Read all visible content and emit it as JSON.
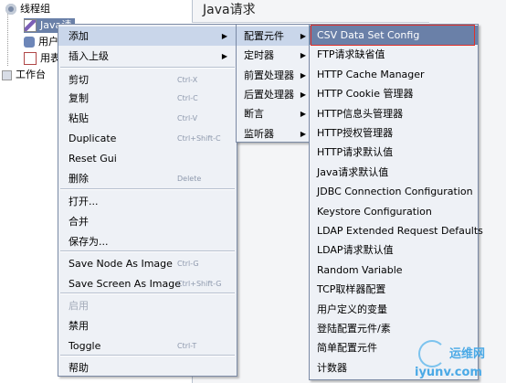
{
  "tree": {
    "items": [
      {
        "label": "线程组",
        "icon": "gear-icon"
      },
      {
        "label": "Java请",
        "icon": "pen-icon"
      },
      {
        "label": "用户",
        "icon": "user-icon"
      },
      {
        "label": "用表",
        "icon": "graph-icon"
      },
      {
        "label": "工作台",
        "icon": "workbench-icon"
      }
    ]
  },
  "panel": {
    "title": "Java请求"
  },
  "context_menu": {
    "items": [
      {
        "label": "添加",
        "accel": "",
        "submenu": true,
        "state": "highlighted"
      },
      {
        "label": "插入上级",
        "accel": "",
        "submenu": true
      },
      {
        "label": "剪切",
        "accel": "Ctrl-X"
      },
      {
        "label": "复制",
        "accel": "Ctrl-C"
      },
      {
        "label": "粘贴",
        "accel": "Ctrl-V"
      },
      {
        "label": "Duplicate",
        "accel": "Ctrl+Shift-C"
      },
      {
        "label": "Reset Gui",
        "accel": ""
      },
      {
        "label": "删除",
        "accel": "Delete"
      },
      {
        "label": "打开...",
        "accel": ""
      },
      {
        "label": "合并",
        "accel": ""
      },
      {
        "label": "保存为...",
        "accel": ""
      },
      {
        "label": "Save Node As Image",
        "accel": "Ctrl-G"
      },
      {
        "label": "Save Screen As Image",
        "accel": "Ctrl+Shift-G"
      },
      {
        "label": "启用",
        "accel": "",
        "state": "disabled"
      },
      {
        "label": "禁用",
        "accel": ""
      },
      {
        "label": "Toggle",
        "accel": "Ctrl-T"
      },
      {
        "label": "帮助",
        "accel": ""
      }
    ]
  },
  "add_submenu": {
    "items": [
      {
        "label": "配置元件",
        "state": "highlighted"
      },
      {
        "label": "定时器"
      },
      {
        "label": "前置处理器"
      },
      {
        "label": "后置处理器"
      },
      {
        "label": "断言"
      },
      {
        "label": "监听器"
      }
    ]
  },
  "config_submenu": {
    "items": [
      {
        "label": "CSV Data Set Config",
        "state": "selected"
      },
      {
        "label": "FTP请求缺省值"
      },
      {
        "label": "HTTP Cache Manager"
      },
      {
        "label": "HTTP Cookie 管理器"
      },
      {
        "label": "HTTP信息头管理器"
      },
      {
        "label": "HTTP授权管理器"
      },
      {
        "label": "HTTP请求默认值"
      },
      {
        "label": "Java请求默认值"
      },
      {
        "label": "JDBC Connection Configuration"
      },
      {
        "label": "Keystore Configuration"
      },
      {
        "label": "LDAP Extended Request Defaults"
      },
      {
        "label": "LDAP请求默认值"
      },
      {
        "label": "Random Variable"
      },
      {
        "label": "TCP取样器配置"
      },
      {
        "label": "用户定义的变量"
      },
      {
        "label": "登陆配置元件/素"
      },
      {
        "label": "简单配置元件"
      },
      {
        "label": "计数器"
      }
    ]
  },
  "watermark": {
    "line1": "运维网",
    "line2": "iyunv.com"
  },
  "colors": {
    "menu_bg": "#eef1f6",
    "highlight": "#c9d6ea",
    "selected": "#6a80a8",
    "annotation_box": "#e0302a"
  }
}
